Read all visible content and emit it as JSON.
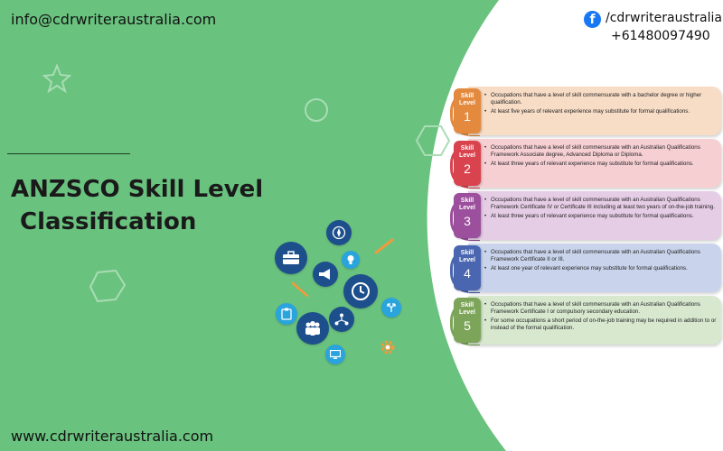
{
  "header": {
    "email": "info@cdrwriteraustralia.com",
    "facebook_handle": "/cdrwriteraustralia",
    "phone": "+61480097490"
  },
  "title": {
    "line1": "ANZSCO Skill Level",
    "line2": "Classification"
  },
  "footer": {
    "website": "www.cdrwriteraustralia.com"
  },
  "colors": {
    "green_bg": "#6ac27f",
    "level1": "#f7dcc6",
    "level2": "#f6cfd3",
    "level3": "#e6cde6",
    "level4": "#c9d4ec",
    "level5": "#d7e8cf",
    "badge1": "#e38a3e",
    "badge2": "#d9434e",
    "badge3": "#9c4f9c",
    "badge4": "#4a66b0",
    "badge5": "#7da55a",
    "icon_navy": "#1d4f8c",
    "icon_blue": "#2aa4dc",
    "icon_orange": "#f39a3a"
  },
  "levels": [
    {
      "label_top": "Skill",
      "label_mid": "Level",
      "number": "1",
      "bullets": [
        "Occupations that have a level of skill commensurate with a bachelor degree or higher qualification.",
        "At least five years of relevant experience may substitute for formal qualifications."
      ]
    },
    {
      "label_top": "Skill",
      "label_mid": "Level",
      "number": "2",
      "bullets": [
        "Occupations that have a level of skill commensurate with an Australian Qualifications Framework Associate degree, Advanced Diploma or Diploma.",
        "At least three years of relevant experience may substitute for formal qualifications."
      ]
    },
    {
      "label_top": "Skill",
      "label_mid": "Level",
      "number": "3",
      "bullets": [
        "Occupations that have a level of skill commensurate with an Australian Qualifications Framework Certificate IV or Certificate III including at least two years of on-the-job training.",
        "At least three years of relevant experience may substitute for formal qualifications."
      ]
    },
    {
      "label_top": "Skill",
      "label_mid": "Level",
      "number": "4",
      "bullets": [
        "Occupations that have a level of skill commensurate with an Australian Qualifications Framework Certificate II or III.",
        "At least one year of relevant experience may substitute for formal qualifications."
      ]
    },
    {
      "label_top": "Skill",
      "label_mid": "Level",
      "number": "5",
      "bullets": [
        "Occupations that have a level of skill commensurate with an Australian Qualifications Framework Certificate I or compulsory secondary education.",
        "For some occupations a short period of on-the-job training may be required in addition to or instead of the formal qualification."
      ]
    }
  ],
  "icons": [
    "briefcase-icon",
    "compass-icon",
    "megaphone-icon",
    "lightbulb-icon",
    "clock-icon",
    "clipboard-icon",
    "team-icon",
    "network-icon",
    "arrows-icon",
    "monitor-icon",
    "gear-icon",
    "pencil-icon"
  ]
}
